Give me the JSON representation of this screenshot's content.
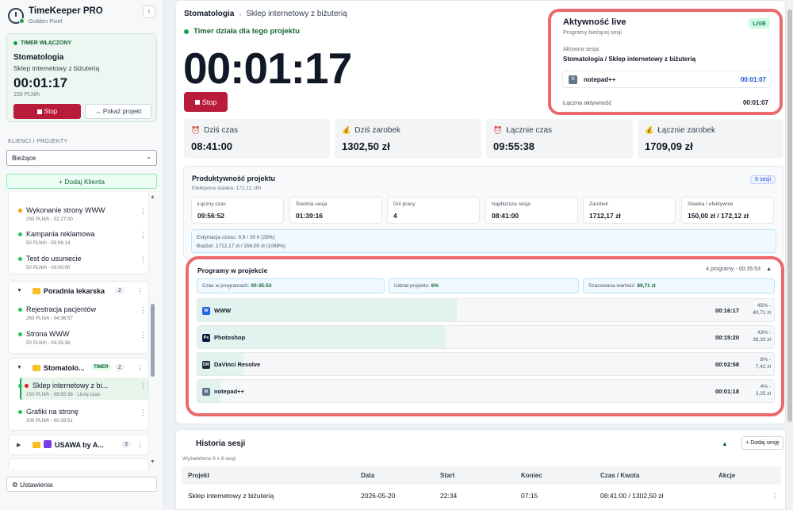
{
  "app": {
    "title": "TimeKeeper PRO",
    "subtitle": "Golden Pixel",
    "collapse_icon": "‹"
  },
  "sidebar": {
    "timer_card": {
      "badge": "TIMER WŁĄCZONY",
      "client": "Stomatologia",
      "project": "Sklep internetowy z biżuterią",
      "time": "00:01:17",
      "rate": "150 PLN/h",
      "stop_label": "Stop",
      "show_label": "→ Pokaż projekt"
    },
    "section_label": "KLIENCI I PROJEKTY",
    "filter_value": "Bieżące",
    "add_client_label": "+ Dodaj Klienta",
    "projects_top": [
      {
        "name": "Wykonanie strony WWW",
        "meta": "290 PLN/h - 02:27:00",
        "dot": "#f59e0b"
      },
      {
        "name": "Kampania reklamowa",
        "meta": "50 PLN/h - 05:06:14",
        "dot": "#22c55e"
      },
      {
        "name": "Test do usuniecie",
        "meta": "50 PLN/h - 00:00:00",
        "dot": "#22c55e"
      }
    ],
    "group_poradnia": {
      "name": "Poradnia lekarska",
      "count": "2",
      "projects": [
        {
          "name": "Rejestracja pacjentów",
          "meta": "260 PLN/h - 04:36:57"
        },
        {
          "name": "Strona WWW",
          "meta": "50 PLN/h - 03:25:38"
        }
      ]
    },
    "group_stomatologia": {
      "name": "Stomatolo...",
      "tag": "TIMER",
      "count": "2",
      "projects": [
        {
          "name": "Sklep internetowy z bi...",
          "meta": "150 PLN/h - 09:55:38 · Liczę czas"
        },
        {
          "name": "Grafiki na stronę",
          "meta": "200 PLN/h - 00:39:51"
        }
      ]
    },
    "group_usawa": {
      "name": "USAWA by A...",
      "count": "3"
    },
    "settings_label": "⚙ Ustawienia"
  },
  "main": {
    "breadcrumb": {
      "client": "Stomatologia",
      "project": "Sklep internetowy z biżuterią"
    },
    "timer_status": "Timer działa dla tego projektu",
    "big_time": "00:01:17",
    "stop_label": "Stop",
    "live": {
      "title": "Aktywność live",
      "subtitle": "Programy bieżącej sesji",
      "tag": "LIVE",
      "active_label": "Aktywna sesja:",
      "active_value": "Stomatologia / Sklep internetowy z biżuterią",
      "app_name": "notepad++",
      "app_time": "00:01:07",
      "total_label": "Łączna aktywność",
      "total_value": "00:01:07"
    },
    "stats": [
      {
        "label": "Dziś czas",
        "value": "08:41:00",
        "icon": "⏰"
      },
      {
        "label": "Dziś zarobek",
        "value": "1302,50 zł",
        "icon": "💰"
      },
      {
        "label": "Łącznie czas",
        "value": "09:55:38",
        "icon": "⏰"
      },
      {
        "label": "Łącznie zarobek",
        "value": "1709,09 zł",
        "icon": "💰"
      }
    ],
    "productivity": {
      "title": "Produktywność projektu",
      "subtitle": "Efektywna stawka: 172,12 zł/h",
      "badge": "6 sesji",
      "metrics": [
        {
          "label": "Łączny czas",
          "value": "09:56:52"
        },
        {
          "label": "Średnia sesja",
          "value": "01:39:16"
        },
        {
          "label": "Dni pracy",
          "value": "4"
        },
        {
          "label": "Najdłuższa sesja",
          "value": "08:41:00"
        },
        {
          "label": "Zarobek",
          "value": "1712,17 zł"
        },
        {
          "label": "Stawka / efektywnie",
          "value": "150,00 zł / 172,12 zł"
        }
      ],
      "estimate_line": "Estymacja czasu: 9,9 / 35 h (28%)",
      "budget_line": "Budżet: 1712,17 zł / 156,00 zł (1098%)"
    },
    "programs": {
      "title": "Programy w projekcie",
      "count": "4 programy - 00:35:53",
      "chip1_label": "Czas w programach: ",
      "chip1_value": "00:35:53",
      "chip2_label": "Udział projektu: ",
      "chip2_value": "6%",
      "chip3_label": "Szacowana wartość: ",
      "chip3_value": "89,71 zł",
      "rows": [
        {
          "name": "WWW",
          "time": "00:16:17",
          "pct": "45% -",
          "value": "40,71 zł",
          "share": 0.45,
          "icon_color": "#2563eb",
          "icon_text": "W"
        },
        {
          "name": "Photoshop",
          "time": "00:15:20",
          "pct": "43% -",
          "value": "38,33 zł",
          "share": 0.43,
          "icon_color": "#0b1a3a",
          "icon_text": "Ps"
        },
        {
          "name": "DaVinci Resolve",
          "time": "00:02:58",
          "pct": "8% -",
          "value": "7,42 zł",
          "share": 0.08,
          "icon_color": "#1f2937",
          "icon_text": "DR"
        },
        {
          "name": "notepad++",
          "time": "00:01:18",
          "pct": "4% -",
          "value": "3,25 zł",
          "share": 0.04,
          "icon_color": "#64748b",
          "icon_text": "N"
        }
      ]
    }
  },
  "history": {
    "title": "Historia sesji",
    "subtitle": "Wyświetlono 6 z 6 sesji",
    "add_label": "+ Dodaj sesję",
    "columns": [
      "Projekt",
      "Data",
      "Start",
      "Koniec",
      "Czas / Kwota",
      "Akcje"
    ],
    "row": {
      "project": "Sklep internetowy z biżuterią",
      "date": "2026-05-20",
      "start": "22:34",
      "end": "07:15",
      "amount": "08:41:00 / 1302,50 zł"
    }
  }
}
